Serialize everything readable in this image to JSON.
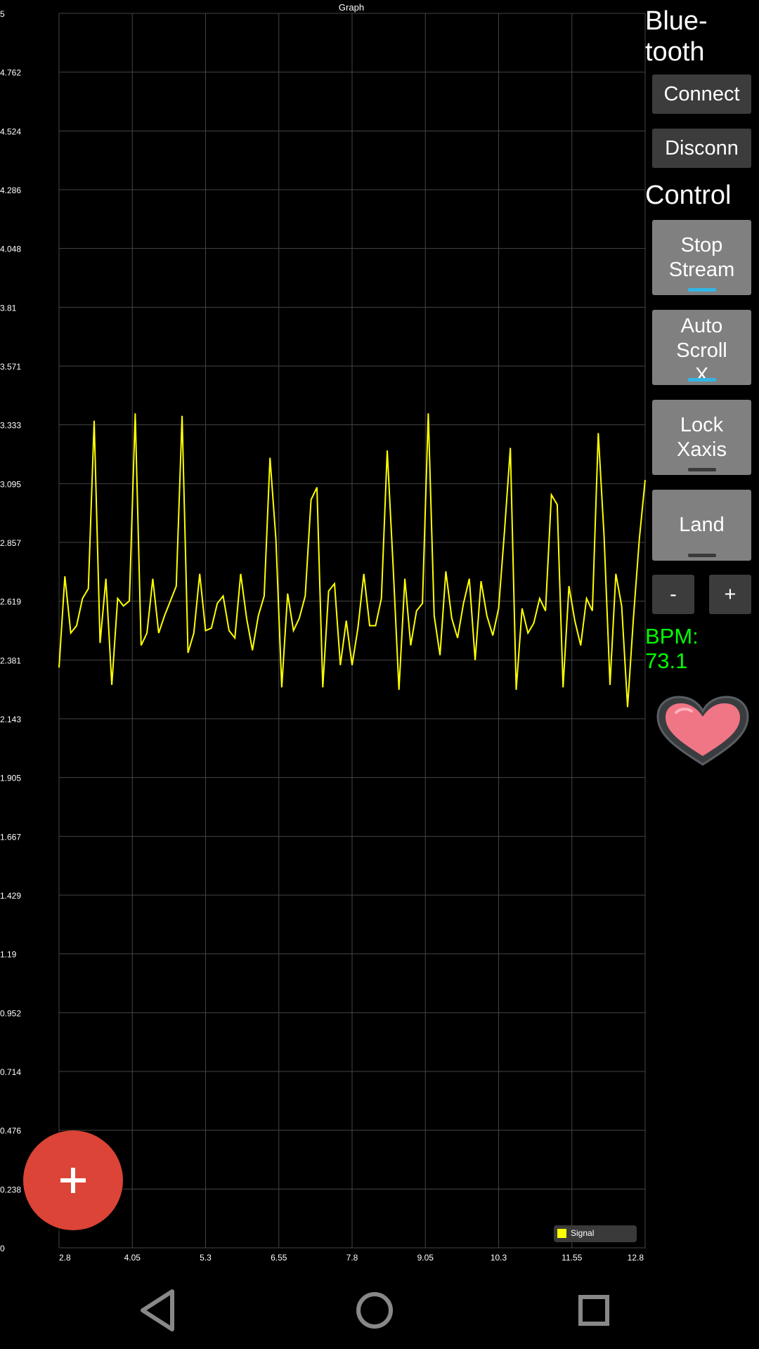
{
  "sidebar": {
    "bluetooth_heading": "Blue-\ntooth",
    "connect_label": "Connect",
    "disconnect_label": "Disconn",
    "control_heading": "Control",
    "stop_stream_label": "Stop\nStream",
    "stop_stream_on": true,
    "auto_scroll_label": "Auto\nScroll\nX",
    "auto_scroll_on": true,
    "lock_xaxis_label": "Lock\nXaxis",
    "lock_xaxis_on": false,
    "land_label": "Land",
    "land_on": false,
    "minus_label": "-",
    "plus_label": "+",
    "bpm_text": "BPM:\n73.1"
  },
  "heart": {
    "icon": "heart-icon",
    "color": "#f07585"
  },
  "fab": {
    "icon": "plus-icon",
    "color": "#db4437"
  },
  "navbar": {
    "icons": [
      "back-icon",
      "home-icon",
      "recents-icon"
    ]
  },
  "chart_data": {
    "type": "line",
    "title": "Graph",
    "xlim": [
      2.8,
      12.8
    ],
    "ylim": [
      0,
      5
    ],
    "xticks": [
      "2.8",
      "4.05",
      "5.3",
      "6.55",
      "7.8",
      "9.05",
      "10.3",
      "11.55",
      "12.8"
    ],
    "yticks": [
      "5",
      "4.762",
      "4.524",
      "4.286",
      "4.048",
      "3.81",
      "3.571",
      "3.333",
      "3.095",
      "2.857",
      "2.619",
      "2.381",
      "2.143",
      "1.905",
      "1.667",
      "1.429",
      "1.19",
      "0.952",
      "0.714",
      "0.476",
      "0.238",
      "0"
    ],
    "grid": true,
    "legend": "bottom-right",
    "series": [
      {
        "name": "Signal",
        "color": "#ffff00",
        "x": [
          2.8,
          2.9,
          3.0,
          3.1,
          3.2,
          3.3,
          3.4,
          3.5,
          3.6,
          3.7,
          3.8,
          3.9,
          4.0,
          4.1,
          4.2,
          4.3,
          4.4,
          4.5,
          4.6,
          4.7,
          4.8,
          4.9,
          5.0,
          5.1,
          5.2,
          5.3,
          5.4,
          5.5,
          5.6,
          5.7,
          5.8,
          5.9,
          6.0,
          6.1,
          6.2,
          6.3,
          6.4,
          6.5,
          6.6,
          6.7,
          6.8,
          6.9,
          7.0,
          7.1,
          7.2,
          7.3,
          7.4,
          7.5,
          7.6,
          7.7,
          7.8,
          7.9,
          8.0,
          8.1,
          8.2,
          8.3,
          8.4,
          8.5,
          8.6,
          8.7,
          8.8,
          8.9,
          9.0,
          9.1,
          9.2,
          9.3,
          9.4,
          9.5,
          9.6,
          9.7,
          9.8,
          9.9,
          10.0,
          10.1,
          10.2,
          10.3,
          10.4,
          10.5,
          10.6,
          10.7,
          10.8,
          10.9,
          11.0,
          11.1,
          11.2,
          11.3,
          11.4,
          11.5,
          11.6,
          11.7,
          11.8,
          11.9,
          12.0,
          12.1,
          12.2,
          12.3,
          12.4,
          12.5,
          12.6,
          12.7,
          12.8
        ],
        "y": [
          2.35,
          2.72,
          2.49,
          2.52,
          2.63,
          2.67,
          3.35,
          2.45,
          2.71,
          2.28,
          2.63,
          2.6,
          2.62,
          3.38,
          2.44,
          2.49,
          2.71,
          2.49,
          2.56,
          2.62,
          2.68,
          3.37,
          2.41,
          2.49,
          2.73,
          2.5,
          2.51,
          2.61,
          2.64,
          2.5,
          2.47,
          2.73,
          2.55,
          2.42,
          2.56,
          2.64,
          3.2,
          2.87,
          2.27,
          2.65,
          2.5,
          2.55,
          2.64,
          3.03,
          3.08,
          2.27,
          2.66,
          2.69,
          2.36,
          2.54,
          2.36,
          2.51,
          2.73,
          2.52,
          2.52,
          2.63,
          3.23,
          2.76,
          2.26,
          2.71,
          2.44,
          2.58,
          2.61,
          3.38,
          2.56,
          2.4,
          2.74,
          2.55,
          2.47,
          2.61,
          2.71,
          2.38,
          2.7,
          2.56,
          2.48,
          2.59,
          2.9,
          3.24,
          2.26,
          2.59,
          2.49,
          2.53,
          2.63,
          2.58,
          3.05,
          3.01,
          2.27,
          2.68,
          2.54,
          2.44,
          2.63,
          2.58,
          3.3,
          2.88,
          2.28,
          2.73,
          2.6,
          2.19,
          2.55,
          2.87,
          3.11
        ]
      }
    ]
  }
}
